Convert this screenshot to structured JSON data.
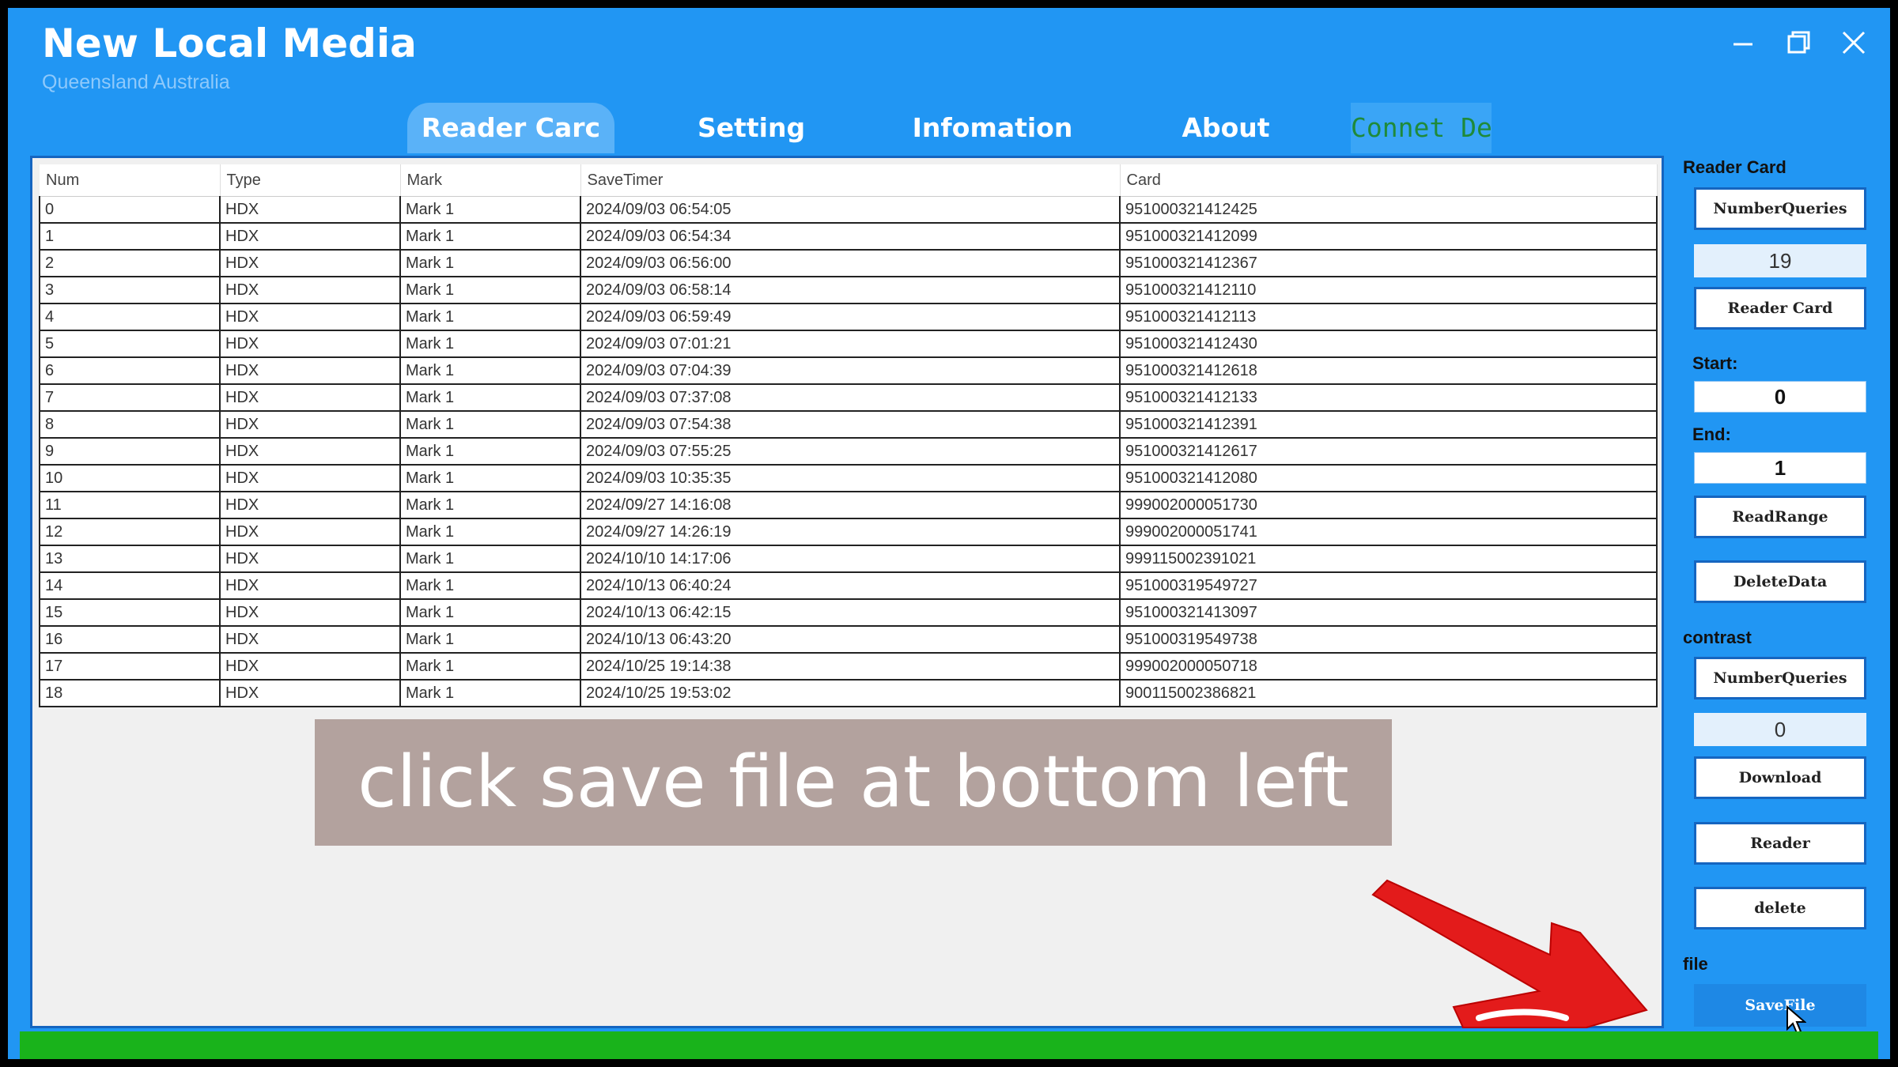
{
  "window": {
    "title": "New Local Media",
    "subtitle": "Queensland Australia",
    "controls": {
      "minimize": "–",
      "maximize": "❐",
      "close": "✕"
    }
  },
  "tabs": [
    {
      "label": "Reader Carc",
      "active": true
    },
    {
      "label": "Setting",
      "active": false
    },
    {
      "label": "Infomation",
      "active": false
    },
    {
      "label": "About",
      "active": false
    },
    {
      "label": "Connet Dev",
      "active": false
    }
  ],
  "table": {
    "columns": [
      "Num",
      "Type",
      "Mark",
      "SaveTimer",
      "Card"
    ],
    "rows": [
      [
        "0",
        "HDX",
        "Mark 1",
        "2024/09/03 06:54:05",
        "951000321412425"
      ],
      [
        "1",
        "HDX",
        "Mark 1",
        "2024/09/03 06:54:34",
        "951000321412099"
      ],
      [
        "2",
        "HDX",
        "Mark 1",
        "2024/09/03 06:56:00",
        "951000321412367"
      ],
      [
        "3",
        "HDX",
        "Mark 1",
        "2024/09/03 06:58:14",
        "951000321412110"
      ],
      [
        "4",
        "HDX",
        "Mark 1",
        "2024/09/03 06:59:49",
        "951000321412113"
      ],
      [
        "5",
        "HDX",
        "Mark 1",
        "2024/09/03 07:01:21",
        "951000321412430"
      ],
      [
        "6",
        "HDX",
        "Mark 1",
        "2024/09/03 07:04:39",
        "951000321412618"
      ],
      [
        "7",
        "HDX",
        "Mark 1",
        "2024/09/03 07:37:08",
        "951000321412133"
      ],
      [
        "8",
        "HDX",
        "Mark 1",
        "2024/09/03 07:54:38",
        "951000321412391"
      ],
      [
        "9",
        "HDX",
        "Mark 1",
        "2024/09/03 07:55:25",
        "951000321412617"
      ],
      [
        "10",
        "HDX",
        "Mark 1",
        "2024/09/03 10:35:35",
        "951000321412080"
      ],
      [
        "11",
        "HDX",
        "Mark 1",
        "2024/09/27 14:16:08",
        "999002000051730"
      ],
      [
        "12",
        "HDX",
        "Mark 1",
        "2024/09/27 14:26:19",
        "999002000051741"
      ],
      [
        "13",
        "HDX",
        "Mark 1",
        "2024/10/10 14:17:06",
        "999115002391021"
      ],
      [
        "14",
        "HDX",
        "Mark 1",
        "2024/10/13 06:40:24",
        "951000319549727"
      ],
      [
        "15",
        "HDX",
        "Mark 1",
        "2024/10/13 06:42:15",
        "951000321413097"
      ],
      [
        "16",
        "HDX",
        "Mark 1",
        "2024/10/13 06:43:20",
        "951000319549738"
      ],
      [
        "17",
        "HDX",
        "Mark 1",
        "2024/10/25 19:14:38",
        "999002000050718"
      ],
      [
        "18",
        "HDX",
        "Mark 1",
        "2024/10/25 19:53:02",
        "900115002386821"
      ]
    ]
  },
  "overlay": {
    "text": "click save file at bottom left"
  },
  "sidebar": {
    "reader_card_label": "Reader Card",
    "number_queries_btn": "NumberQueries",
    "number_queries_value": "19",
    "reader_card_btn": "Reader Card",
    "start_label": "Start:",
    "start_value": "0",
    "end_label": "End:",
    "end_value": "1",
    "read_range_btn": "ReadRange",
    "delete_data_btn": "DeleteData",
    "contrast_label": "contrast",
    "contrast_number_queries_btn": "NumberQueries",
    "contrast_value": "0",
    "download_btn": "Download",
    "reader_btn": "Reader",
    "delete_btn": "delete",
    "file_label": "file",
    "save_file_btn": "SaveFile"
  },
  "colors": {
    "window_bg": "#2196f3",
    "active_tab": "#5ab2f8",
    "status_bar": "#19b31b",
    "primary_button": "#1e88e5",
    "arrow": "#e31b1b"
  }
}
